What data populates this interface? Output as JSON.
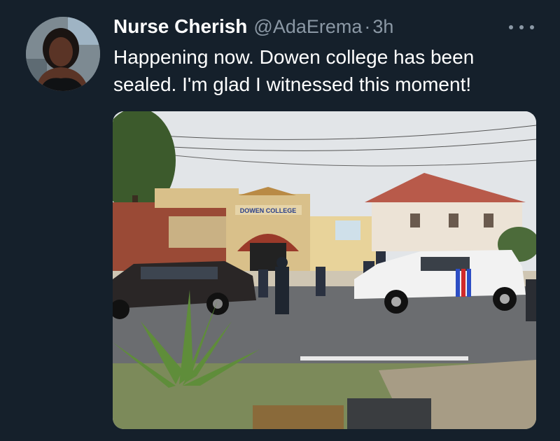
{
  "tweet": {
    "display_name": "Nurse Cherish",
    "handle": "@AdaErema",
    "separator": "·",
    "timestamp": "3h",
    "text": "Happening now. Dowen college has been sealed. I'm glad I witnessed this moment!"
  },
  "media": {
    "sign_text": "DOWEN COLLEGE"
  },
  "colors": {
    "background": "#15202b",
    "text": "#ffffff",
    "secondary_text": "#8b98a5"
  },
  "icons": {
    "more": "more-options-icon"
  }
}
